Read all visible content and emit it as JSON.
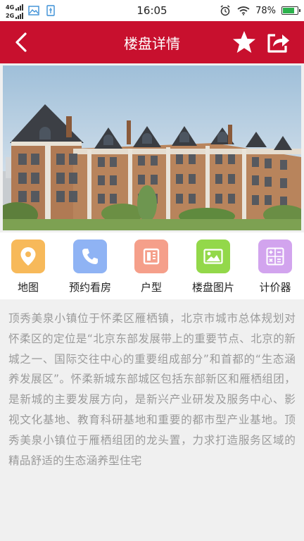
{
  "status_bar": {
    "network_top": "4G",
    "network_bottom": "2G",
    "time": "16:05",
    "battery_percent": "78%",
    "battery_level": 0.78
  },
  "header": {
    "title": "楼盘详情",
    "back_icon": "chevron-left-icon",
    "favorite_icon": "star-icon",
    "share_icon": "share-icon"
  },
  "hero": {
    "image": "residential-building-photo"
  },
  "quick_nav": [
    {
      "label": "地图",
      "icon": "map-pin-icon",
      "color": "#f7b95a"
    },
    {
      "label": "预约看房",
      "icon": "phone-icon",
      "color": "#8fb3f4"
    },
    {
      "label": "户型",
      "icon": "floor-plan-icon",
      "color": "#f59f8a"
    },
    {
      "label": "楼盘图片",
      "icon": "image-icon",
      "color": "#93d84a"
    },
    {
      "label": "计价器",
      "icon": "calculator-icon",
      "color": "#d2a4ee"
    }
  ],
  "description": "顶秀美泉小镇位于怀柔区雁栖镇，北京市城市总体规划对怀柔区的定位是“北京东部发展带上的重要节点、北京的新城之一、国际交往中心的重要组成部分”和首都的“生态涵养发展区”。怀柔新城东部城区包括东部新区和雁栖组团，是新城的主要发展方向，是新兴产业研发及服务中心、影视文化基地、教育科研基地和重要的都市型产业基地。顶秀美泉小镇位于雁栖组团的龙头置，力求打造服务区域的精品舒适的生态涵养型住宅"
}
